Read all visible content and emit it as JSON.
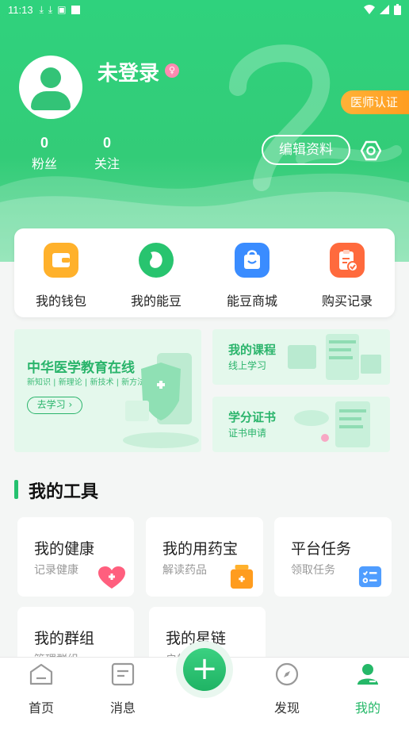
{
  "status_bar": {
    "time": "11:13"
  },
  "profile": {
    "username": "未登录",
    "gender_symbol": "♀",
    "doctor_cert_label": "医师认证",
    "stats": [
      {
        "value": "0",
        "label": "粉丝"
      },
      {
        "value": "0",
        "label": "关注"
      }
    ],
    "edit_label": "编辑资料"
  },
  "quick_actions": [
    {
      "label": "我的钱包",
      "icon": "wallet-icon",
      "color": "#ffb12b"
    },
    {
      "label": "我的能豆",
      "icon": "bean-icon",
      "color": "#28c46f"
    },
    {
      "label": "能豆商城",
      "icon": "shopping-bag-icon",
      "color": "#3a8cff"
    },
    {
      "label": "购买记录",
      "icon": "clipboard-check-icon",
      "color": "#ff6a3d"
    }
  ],
  "banners": {
    "main": {
      "title": "中华医学教育在线",
      "subtitle": "新知识 | 新理论 | 新技术 | 新方法",
      "cta": "去学习"
    },
    "courses": {
      "title": "我的课程",
      "subtitle": "线上学习"
    },
    "credits": {
      "title": "学分证书",
      "subtitle": "证书申请"
    }
  },
  "tools": {
    "section_title": "我的工具",
    "items": [
      {
        "title": "我的健康",
        "subtitle": "记录健康",
        "icon": "heart-plus-icon"
      },
      {
        "title": "我的用药宝",
        "subtitle": "解读药品",
        "icon": "medicine-box-icon"
      },
      {
        "title": "平台任务",
        "subtitle": "领取任务",
        "icon": "task-list-icon"
      },
      {
        "title": "我的群组",
        "subtitle": "管理群组",
        "icon": "group-icon"
      },
      {
        "title": "我的星链",
        "subtitle": "启航",
        "icon": "star-link-icon"
      }
    ]
  },
  "bottom_nav": {
    "items": [
      {
        "label": "首页",
        "icon": "home-icon"
      },
      {
        "label": "消息",
        "icon": "message-icon"
      },
      {
        "label": "发现",
        "icon": "compass-icon"
      },
      {
        "label": "我的",
        "icon": "profile-icon"
      }
    ],
    "active": "我的",
    "active_color": "#25b868"
  },
  "colors": {
    "brand": "#2fd27d",
    "accent": "#ff9c1e"
  }
}
